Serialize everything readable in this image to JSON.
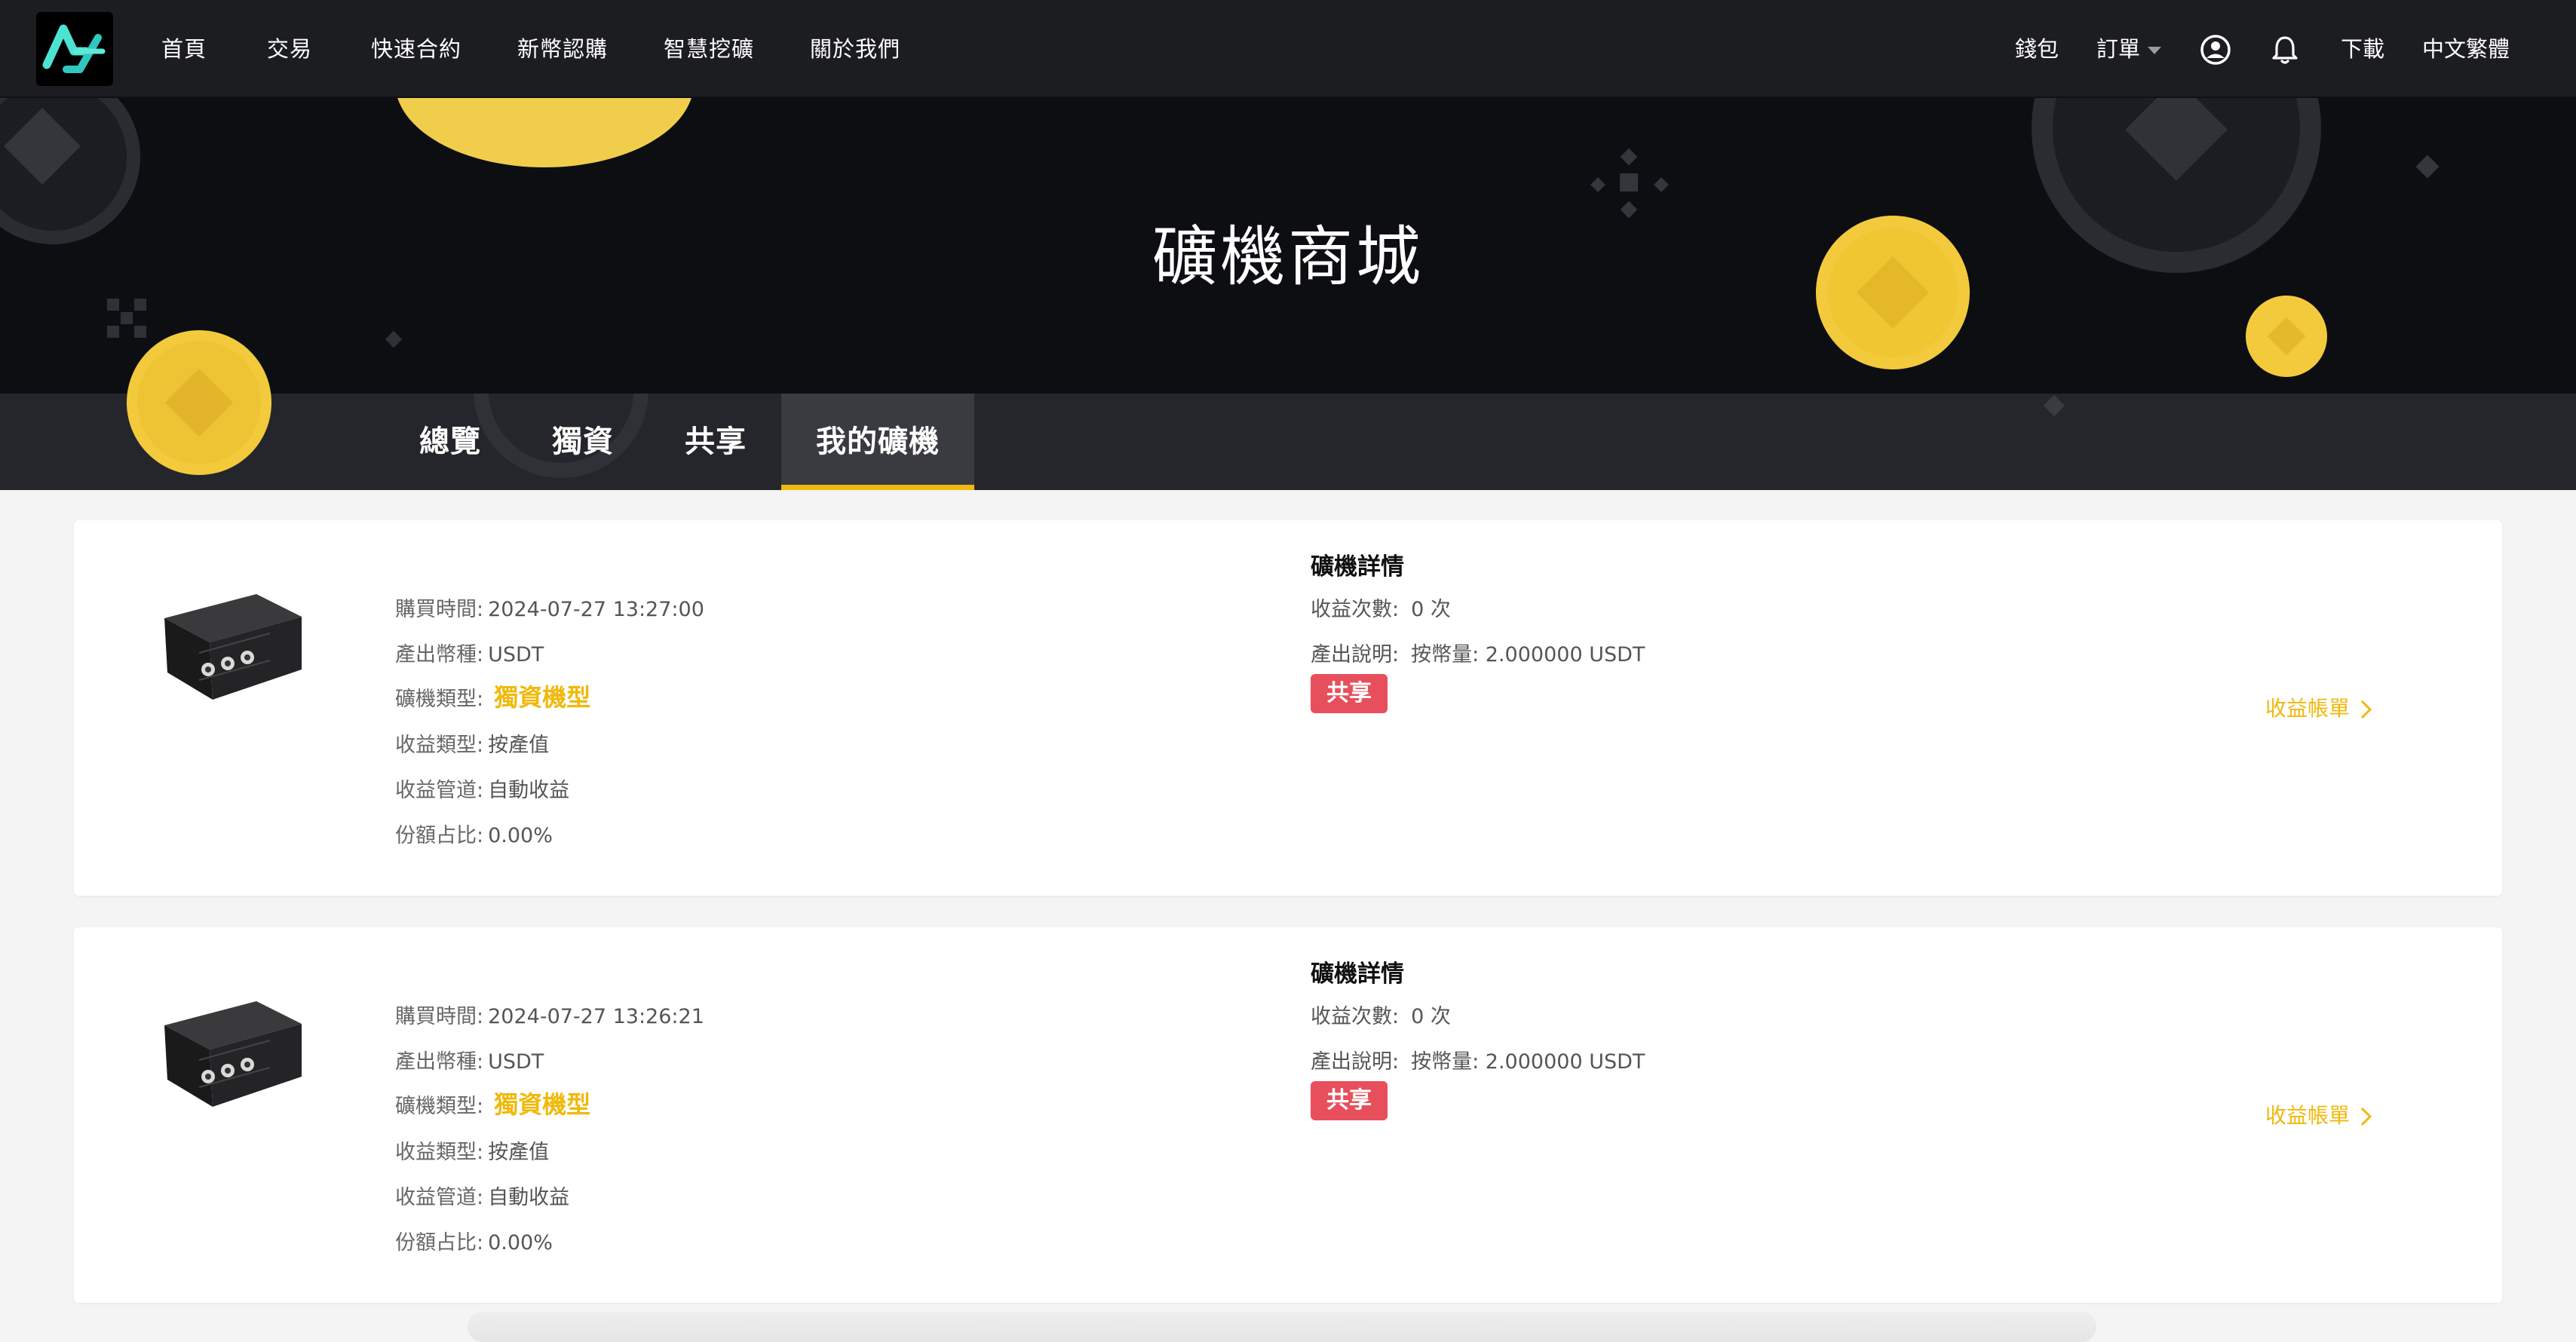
{
  "nav": {
    "items": [
      "首頁",
      "交易",
      "快速合約",
      "新幣認購",
      "智慧挖礦",
      "關於我們"
    ],
    "wallet": "錢包",
    "orders": "訂單",
    "download": "下載",
    "language": "中文繁體"
  },
  "hero": {
    "title": "礦機商城"
  },
  "tabs": [
    "總覽",
    "獨資",
    "共享",
    "我的礦機"
  ],
  "active_tab": "我的礦機",
  "colors": {
    "accent": "#f0b90b",
    "badge": "#e84f5c",
    "nav_bg": "#1c1d21",
    "hero_bg": "#0d0e11"
  },
  "orders": [
    {
      "purchase_time_label": "購買時間:",
      "purchase_time": "2024-07-27 13:27:00",
      "output_currency_label": "產出幣種:",
      "output_currency": "USDT",
      "miner_type_label": "礦機類型:",
      "miner_type": "獨資機型",
      "income_type_label": "收益類型:",
      "income_type": "按產值",
      "income_channel_label": "收益管道:",
      "income_channel": "自動收益",
      "share_ratio_label": "份額占比:",
      "share_ratio": "0.00%",
      "detail_title": "礦機詳情",
      "income_count_label": "收益次數:",
      "income_count": "0 次",
      "output_desc_label": "產出說明:",
      "output_desc": "按幣量: 2.000000 USDT",
      "badge": "共享",
      "earnings_link": "收益帳單"
    },
    {
      "purchase_time_label": "購買時間:",
      "purchase_time": "2024-07-27 13:26:21",
      "output_currency_label": "產出幣種:",
      "output_currency": "USDT",
      "miner_type_label": "礦機類型:",
      "miner_type": "獨資機型",
      "income_type_label": "收益類型:",
      "income_type": "按產值",
      "income_channel_label": "收益管道:",
      "income_channel": "自動收益",
      "share_ratio_label": "份額占比:",
      "share_ratio": "0.00%",
      "detail_title": "礦機詳情",
      "income_count_label": "收益次數:",
      "income_count": "0 次",
      "output_desc_label": "產出說明:",
      "output_desc": "按幣量: 2.000000 USDT",
      "badge": "共享",
      "earnings_link": "收益帳單"
    }
  ]
}
